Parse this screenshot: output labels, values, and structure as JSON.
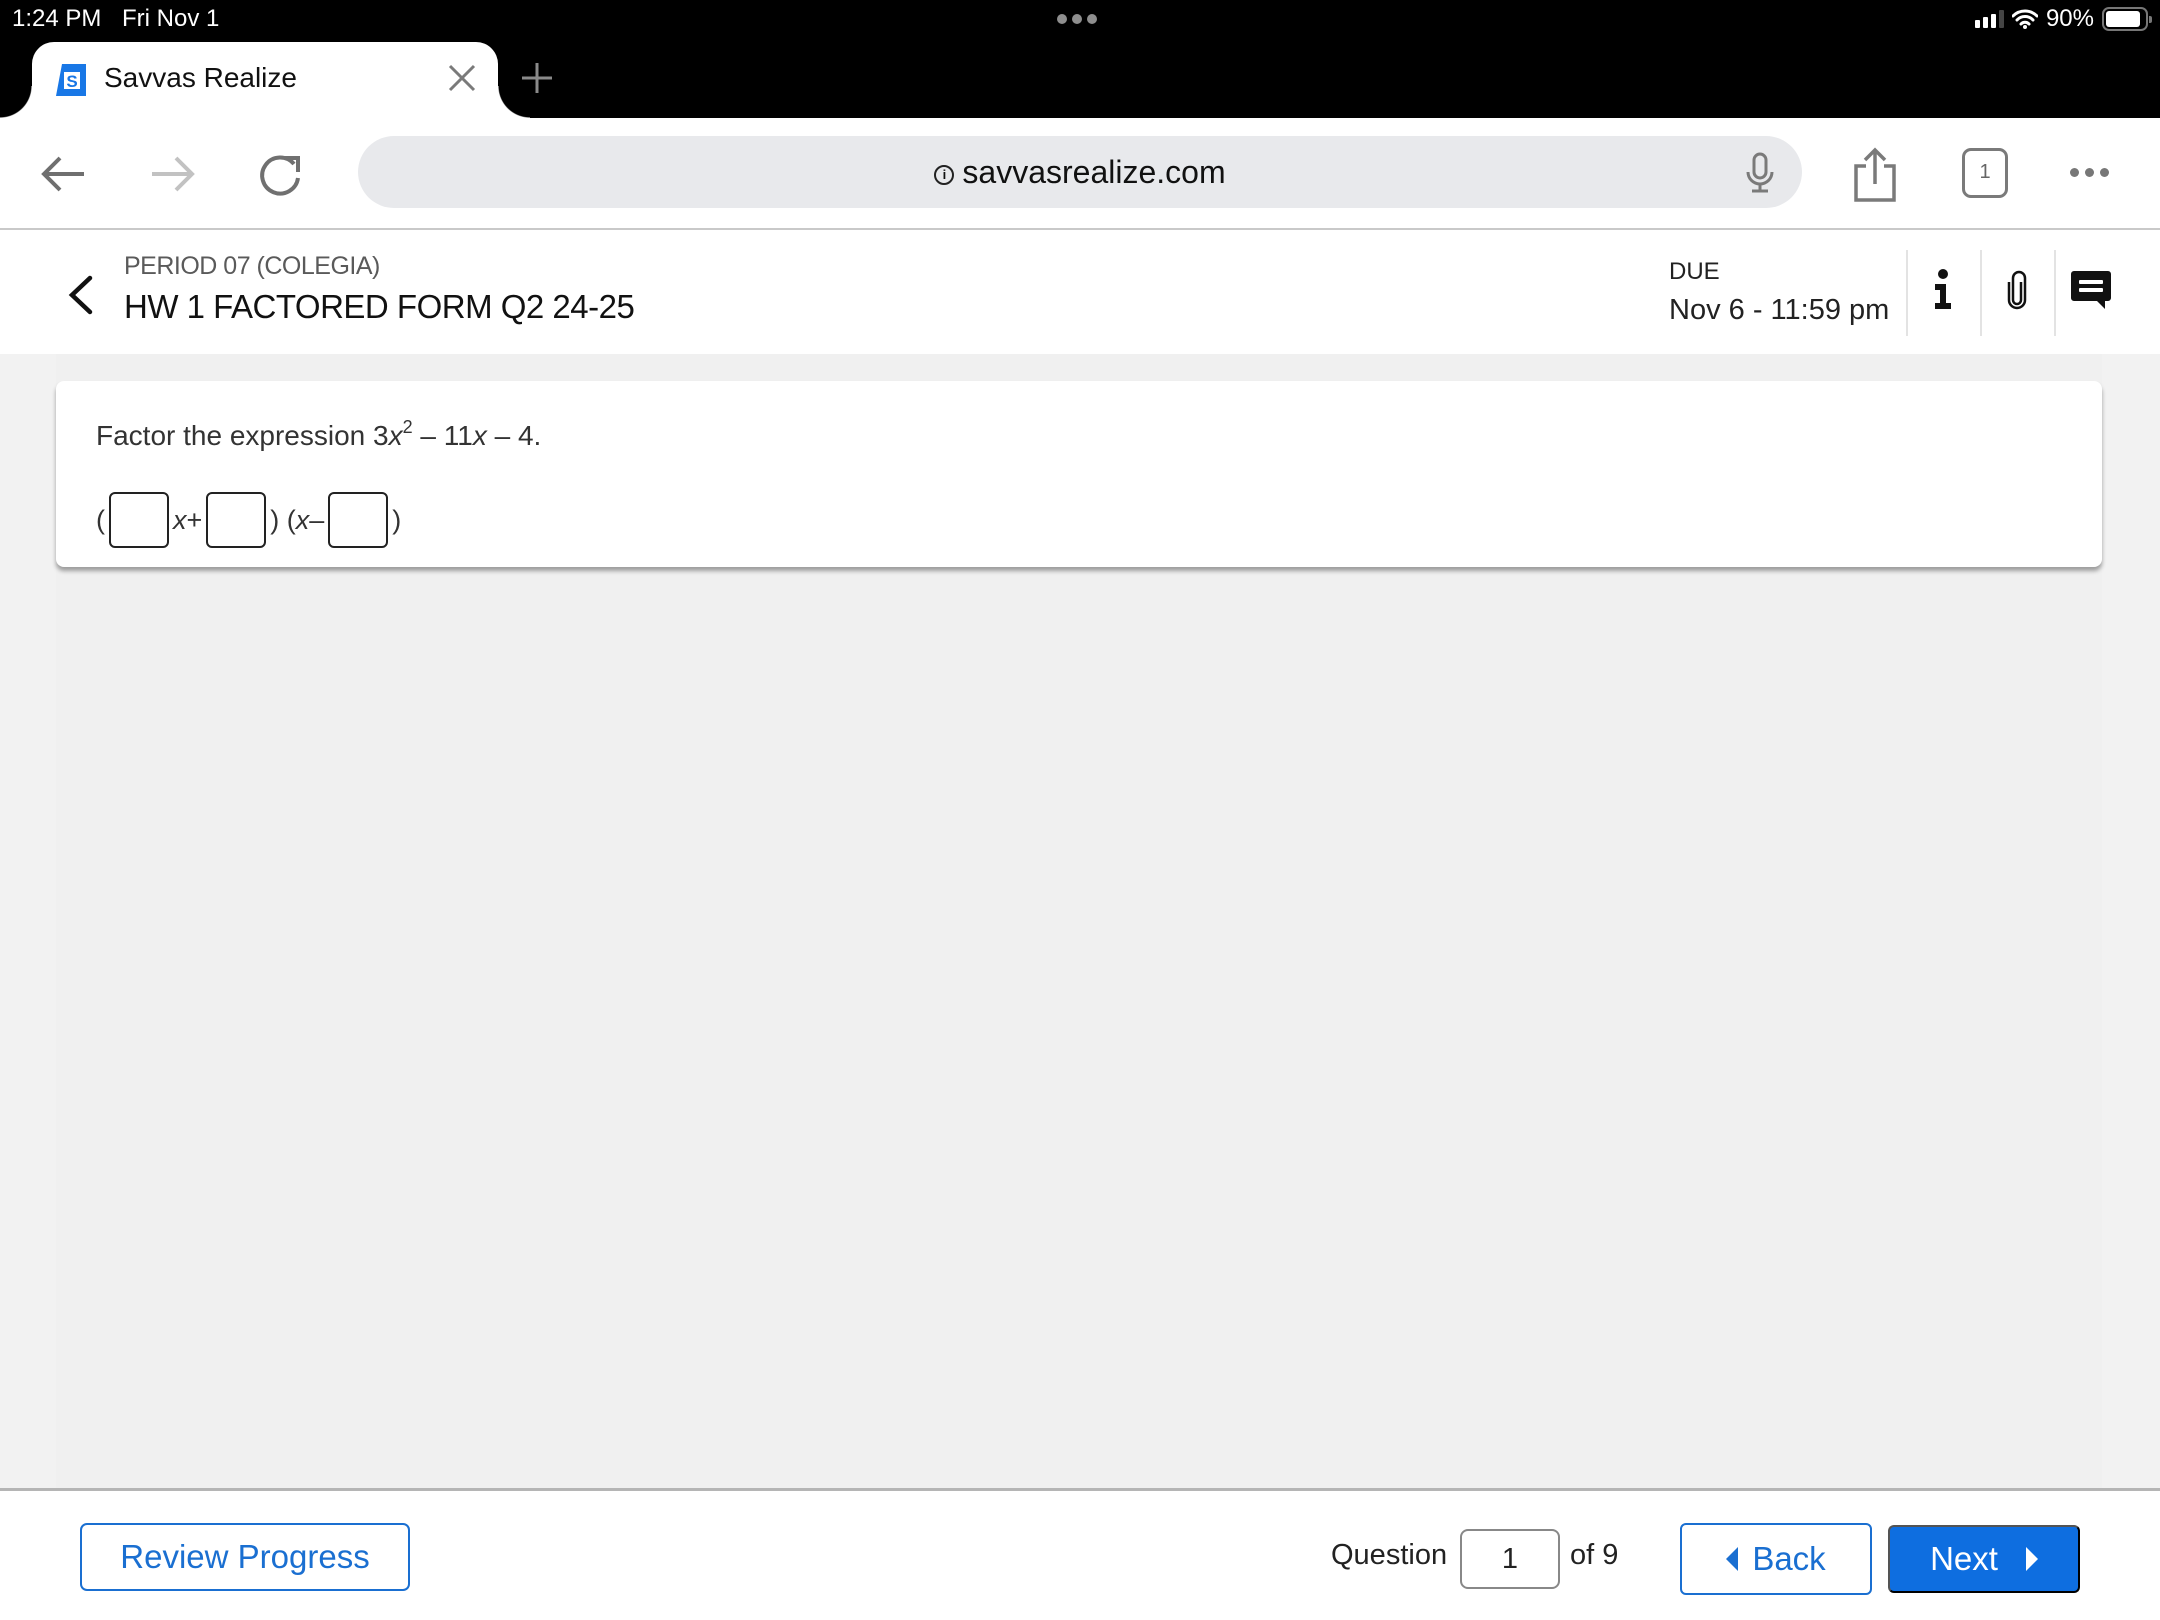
{
  "status_bar": {
    "time": "1:24 PM",
    "date": "Fri Nov 1",
    "battery_percent": "90%",
    "battery_level": 0.9,
    "icons": [
      "cellular-signal-icon",
      "wifi-icon",
      "battery-icon"
    ]
  },
  "browser": {
    "tab": {
      "title": "Savvas Realize",
      "favicon": "savvas-logo-icon",
      "close_icon": "close-icon"
    },
    "new_tab_icon": "plus-icon",
    "url": "savvasrealize.com",
    "tab_count": "1",
    "icons": {
      "back": "arrow-left-icon",
      "forward": "arrow-right-icon",
      "reload": "reload-icon",
      "site_info": "info-circle-icon",
      "mic": "microphone-icon",
      "share": "share-icon",
      "tabs": "tabs-icon",
      "more": "more-dots-icon"
    }
  },
  "assignment": {
    "class_name": "PERIOD 07 (COLEGIA)",
    "title": "HW 1 FACTORED FORM Q2 24-25",
    "due_label": "DUE",
    "due_date": "Nov 6 - 11:59 pm",
    "header_icons": [
      "info-icon",
      "paperclip-icon",
      "comment-icon"
    ]
  },
  "question": {
    "prompt_prefix": "Factor the expression 3",
    "var": "x",
    "exponent": "2",
    "middle": " – 11",
    "suffix": " – 4.",
    "answer": {
      "open_paren": "(",
      "x_plus": " + ",
      "close_open": ") (",
      "x_minus": " –",
      "close": ")",
      "boxes": [
        "",
        "",
        ""
      ]
    }
  },
  "footer": {
    "review_label": "Review Progress",
    "question_label": "Question",
    "question_number": "1",
    "of_label": "of 9",
    "back_label": "Back",
    "next_label": "Next"
  },
  "colors": {
    "accent": "#0e6ee0",
    "accent_outline": "#1a6fd1",
    "chrome_black": "#000000",
    "urlbar_bg": "#e8e9ec",
    "content_bg": "#f2f2f2"
  }
}
